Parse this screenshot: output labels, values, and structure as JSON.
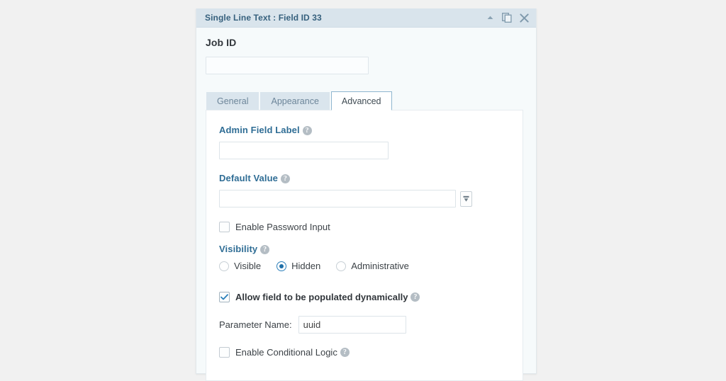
{
  "panel": {
    "title": "Single Line Text : Field ID 33",
    "icons": {
      "collapse": "caret-up-icon",
      "duplicate": "duplicate-icon",
      "close": "close-icon"
    },
    "field_label": "Job ID",
    "field_label_input_value": "",
    "field_label_input_placeholder": ""
  },
  "tabs": [
    {
      "label": "General",
      "active": false
    },
    {
      "label": "Appearance",
      "active": false
    },
    {
      "label": "Advanced",
      "active": true
    }
  ],
  "settings": {
    "admin_field_label": {
      "label": "Admin Field Label",
      "help": "?",
      "value": "",
      "placeholder": ""
    },
    "default_value": {
      "label": "Default Value",
      "help": "?",
      "value": "",
      "placeholder": "",
      "merge_tag_button": "merge-tag-icon"
    },
    "enable_password_input": {
      "label": "Enable Password Input",
      "checked": false
    },
    "visibility": {
      "label": "Visibility",
      "help": "?",
      "options": [
        {
          "label": "Visible",
          "selected": false
        },
        {
          "label": "Hidden",
          "selected": true
        },
        {
          "label": "Administrative",
          "selected": false
        }
      ]
    },
    "allow_dynamic_population": {
      "label": "Allow field to be populated dynamically",
      "help": "?",
      "checked": true
    },
    "parameter_name": {
      "label": "Parameter Name:",
      "value": "uuid",
      "placeholder": ""
    },
    "enable_conditional_logic": {
      "label": "Enable Conditional Logic",
      "help": "?",
      "checked": false
    }
  },
  "colors": {
    "header_bg": "#d9e4ec",
    "header_text": "#36607d",
    "panel_bg": "#f6fafb",
    "page_bg": "#f1f1f1",
    "label_blue": "#2f6d95",
    "accent_blue": "#1f6fa8",
    "tab_inactive_bg": "#dae5ed"
  }
}
